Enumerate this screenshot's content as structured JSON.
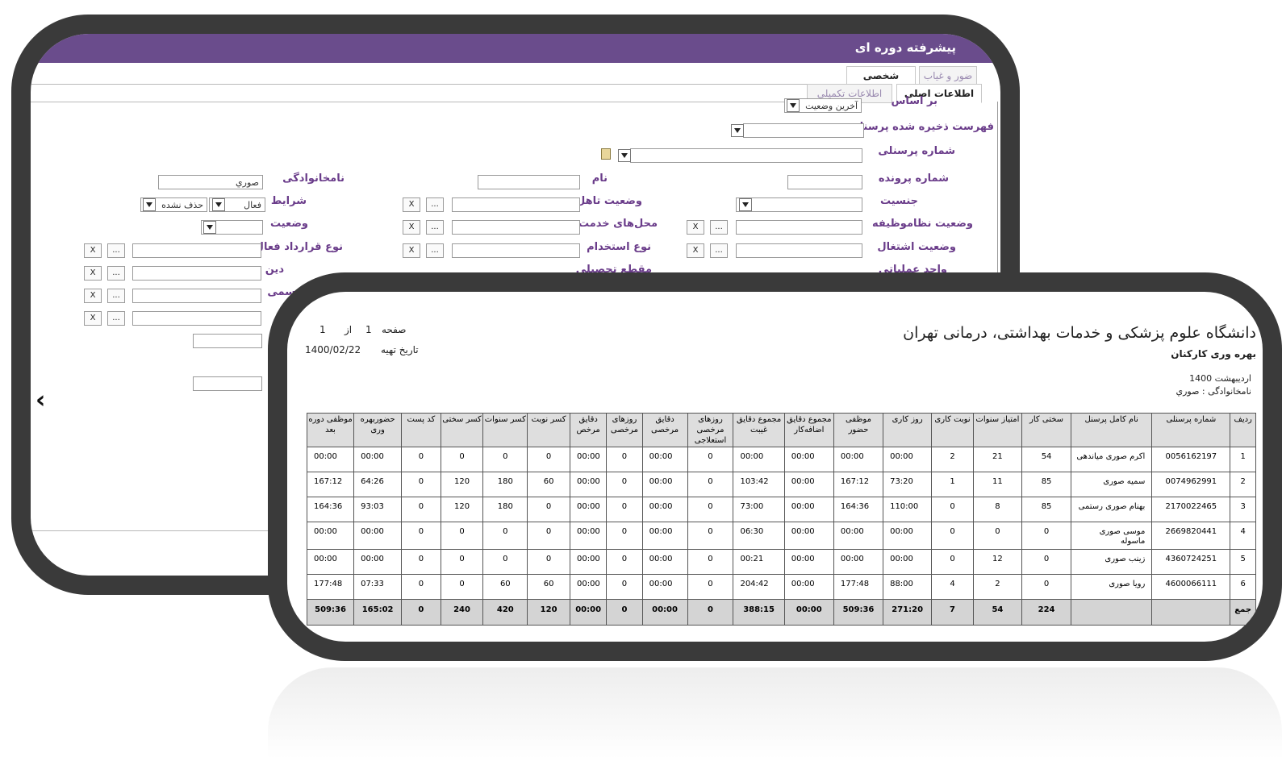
{
  "form": {
    "title": "پیشرفته دوره ای",
    "tabs_top": [
      "شخصی",
      "ضور و غیاب"
    ],
    "tabs_sub": [
      "اطلاعات اصلی",
      "اطلاعات تکمیلی"
    ],
    "fields": {
      "based_on_label": "بر اساس",
      "based_on_value": "آخرین وضعیت",
      "saved_list_label": "فهرست ذخیره شده پرسنل",
      "personnel_no_label": "شماره پرسنلی",
      "file_no_label": "شماره پرونده",
      "name_label": "نام",
      "family_label": "نامخانوادگی",
      "family_value": "صوري",
      "gender_label": "جنسیت",
      "marital_label": "وضعیت تاهل",
      "conditions_label": "شرایط",
      "cond_active": "فعال",
      "cond_deleted": "حذف نشده",
      "military_label": "وضعیت نظاموظیفه",
      "service_loc_label": "محل‌های خدمت",
      "status_label": "وضعیت",
      "employment_label": "وضعیت اشتغال",
      "hire_type_label": "نوع استخدام",
      "contract_label": "نوع قرارداد فعال",
      "op_unit_label": "واحد عملیاتی",
      "edu_label": "مقطع تحصیلی",
      "religion_label": "دین",
      "partial_label": "سمی"
    },
    "btn_x": "X",
    "btn_more": "..."
  },
  "report": {
    "page_label": "صفحه",
    "page_no": "1",
    "of_label": "از",
    "page_total": "1",
    "date_label": "تاریخ تهیه",
    "date_value": "1400/02/22",
    "org": "دانشگاه علوم پزشکی و خدمات بهداشتی، درمانی تهران",
    "subtitle": "بهره وری کارکنان",
    "month": "اردیبهشت 1400",
    "family_filter": "نامخانوادگی : صوري",
    "headers": [
      "ردیف",
      "شماره پرسنلی",
      "نام کامل پرسنل",
      "سختی کار",
      "امتیاز سنوات",
      "نوبت کاری",
      "روز کاری",
      "موظفی حضور",
      "مجموع دقایق اضافه‌کار",
      "مجموع دقایق غیبت",
      "روزهای مرخصی استعلاجی",
      "دقایق مرخصی",
      "روزهای مرخصی",
      "دقایق مرخص",
      "کسر نوبت",
      "کسر سنوات",
      "کسر سختی",
      "کد پست",
      "حضوربهره وری",
      "موظفی دوره بعد"
    ],
    "rows": [
      [
        "1",
        "0056162197",
        "اکرم صوری میاندهی",
        "54",
        "21",
        "2",
        "00:00",
        "00:00",
        "00:00",
        "00:00",
        "0",
        "00:00",
        "0",
        "00:00",
        "0",
        "0",
        "0",
        "0",
        "00:00",
        "00:00"
      ],
      [
        "2",
        "0074962991",
        "سمیه صوری",
        "85",
        "11",
        "1",
        "73:20",
        "167:12",
        "00:00",
        "103:42",
        "0",
        "00:00",
        "0",
        "00:00",
        "60",
        "180",
        "120",
        "0",
        "64:26",
        "167:12"
      ],
      [
        "3",
        "2170022465",
        "بهنام صوری رستمی",
        "85",
        "8",
        "0",
        "110:00",
        "164:36",
        "00:00",
        "73:00",
        "0",
        "00:00",
        "0",
        "00:00",
        "0",
        "180",
        "120",
        "0",
        "93:03",
        "164:36"
      ],
      [
        "4",
        "2669820441",
        "موسی صوری ماسوله",
        "0",
        "0",
        "0",
        "00:00",
        "00:00",
        "00:00",
        "06:30",
        "0",
        "00:00",
        "0",
        "00:00",
        "0",
        "0",
        "0",
        "0",
        "00:00",
        "00:00"
      ],
      [
        "5",
        "4360724251",
        "زینب صوری",
        "0",
        "12",
        "0",
        "00:00",
        "00:00",
        "00:00",
        "00:21",
        "0",
        "00:00",
        "0",
        "00:00",
        "0",
        "0",
        "0",
        "0",
        "00:00",
        "00:00"
      ],
      [
        "6",
        "4600066111",
        "رویا صوری",
        "0",
        "2",
        "4",
        "88:00",
        "177:48",
        "00:00",
        "204:42",
        "0",
        "00:00",
        "0",
        "00:00",
        "60",
        "60",
        "0",
        "0",
        "07:33",
        "177:48"
      ]
    ],
    "total": [
      "جمع",
      "",
      "",
      "224",
      "54",
      "7",
      "271:20",
      "509:36",
      "00:00",
      "388:15",
      "0",
      "00:00",
      "0",
      "00:00",
      "120",
      "420",
      "240",
      "0",
      "165:02",
      "509:36"
    ]
  },
  "colors": {
    "frame": "#3a3a3a",
    "titlebar": "#6a4c8c",
    "label": "#6a3c8a"
  }
}
